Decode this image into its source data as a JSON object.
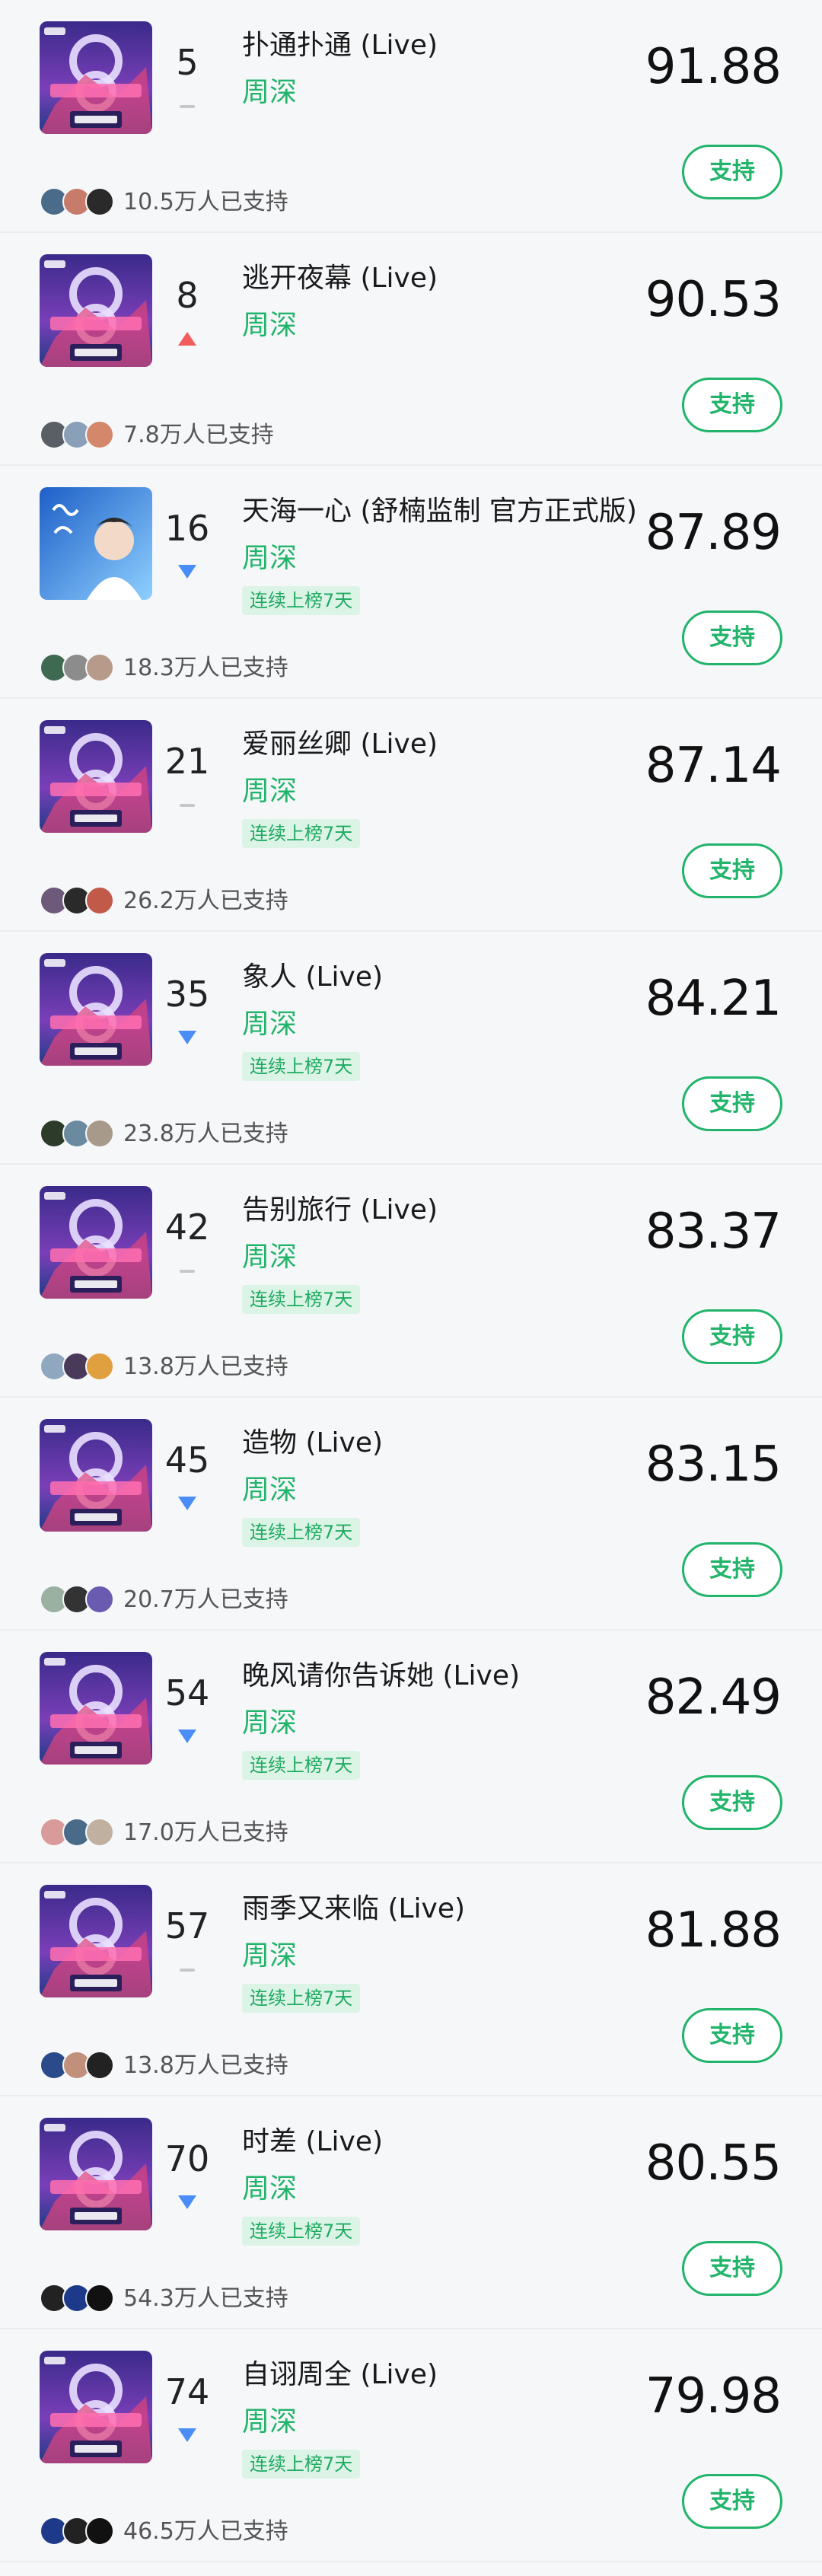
{
  "support_label": "支持",
  "entries": [
    {
      "rank": "5",
      "trend": "flat",
      "title": "扑通扑通 (Live)",
      "artist": "周深",
      "badge": "",
      "score": "91.88",
      "supporters": "10.5万人已支持",
      "cover": "episode",
      "cover_caption": "第6期"
    },
    {
      "rank": "8",
      "trend": "up",
      "title": "逃开夜幕 (Live)",
      "artist": "周深",
      "badge": "",
      "score": "90.53",
      "supporters": "7.8万人已支持",
      "cover": "episode",
      "cover_caption": "第6期"
    },
    {
      "rank": "16",
      "trend": "down",
      "title": "天海一心 (舒楠监制 官方正式版)",
      "artist": "周深",
      "badge": "连续上榜7天",
      "score": "87.89",
      "supporters": "18.3万人已支持",
      "cover": "portrait",
      "cover_caption": ""
    },
    {
      "rank": "21",
      "trend": "flat",
      "title": "爱丽丝卿 (Live)",
      "artist": "周深",
      "badge": "连续上榜7天",
      "score": "87.14",
      "supporters": "26.2万人已支持",
      "cover": "episode",
      "cover_caption": "第5期"
    },
    {
      "rank": "35",
      "trend": "down",
      "title": "象人 (Live)",
      "artist": "周深",
      "badge": "连续上榜7天",
      "score": "84.21",
      "supporters": "23.8万人已支持",
      "cover": "episode",
      "cover_caption": "第4期"
    },
    {
      "rank": "42",
      "trend": "flat",
      "title": "告别旅行 (Live)",
      "artist": "周深",
      "badge": "连续上榜7天",
      "score": "83.37",
      "supporters": "13.8万人已支持",
      "cover": "episode",
      "cover_caption": "第5期"
    },
    {
      "rank": "45",
      "trend": "down",
      "title": "造物 (Live)",
      "artist": "周深",
      "badge": "连续上榜7天",
      "score": "83.15",
      "supporters": "20.7万人已支持",
      "cover": "episode",
      "cover_caption": "第3期"
    },
    {
      "rank": "54",
      "trend": "down",
      "title": "晚风请你告诉她 (Live)",
      "artist": "周深",
      "badge": "连续上榜7天",
      "score": "82.49",
      "supporters": "17.0万人已支持",
      "cover": "episode",
      "cover_caption": "第3期"
    },
    {
      "rank": "57",
      "trend": "flat",
      "title": "雨季又来临 (Live)",
      "artist": "周深",
      "badge": "连续上榜7天",
      "score": "81.88",
      "supporters": "13.8万人已支持",
      "cover": "episode",
      "cover_caption": "第4期"
    },
    {
      "rank": "70",
      "trend": "down",
      "title": "时差 (Live)",
      "artist": "周深",
      "badge": "连续上榜7天",
      "score": "80.55",
      "supporters": "54.3万人已支持",
      "cover": "episode",
      "cover_caption": "第1期"
    },
    {
      "rank": "74",
      "trend": "down",
      "title": "自诩周全 (Live)",
      "artist": "周深",
      "badge": "连续上榜7天",
      "score": "79.98",
      "supporters": "46.5万人已支持",
      "cover": "episode",
      "cover_caption": "第1期"
    }
  ],
  "colors": {
    "accent": "#22b46a",
    "trend_up": "#f25c5c",
    "trend_down": "#4a8df6",
    "trend_flat": "#c8c8c8"
  }
}
